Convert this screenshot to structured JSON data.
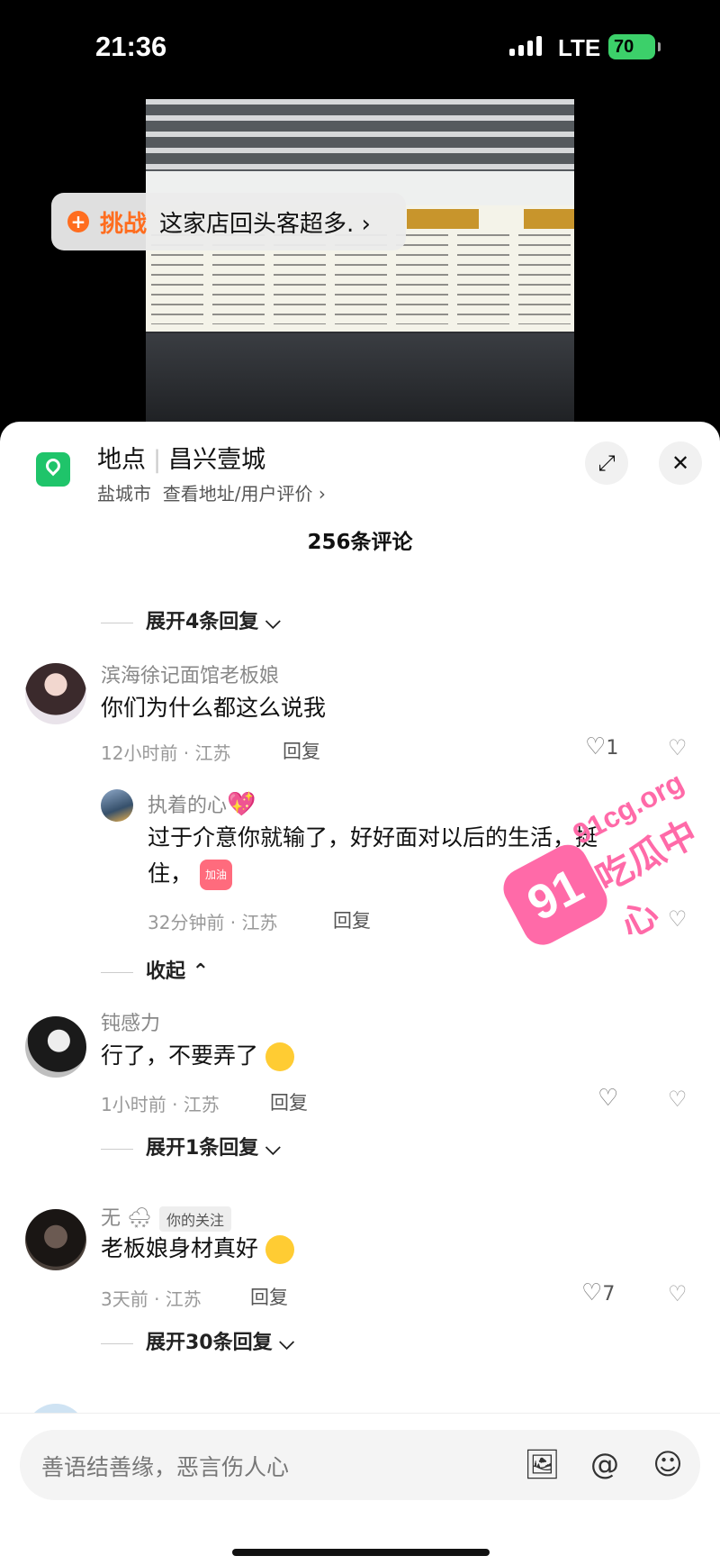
{
  "status_bar": {
    "time": "21:36",
    "network": "LTE",
    "battery": "70"
  },
  "video": {
    "challenge_label": "挑战",
    "challenge_text": "这家店回头客超多.",
    "chevron": "›"
  },
  "location": {
    "title_prefix": "地点",
    "name": "昌兴壹城",
    "city": "盐城市",
    "link": "查看地址/用户评价 ›",
    "icon": "location-pin-icon"
  },
  "comments_count": "256条评论",
  "expand_top": "展开4条回复 ⌵",
  "comments": [
    {
      "user": "滨海徐记面馆老板娘",
      "text": "你们为什么都这么说我",
      "meta": "12小时前 · 江苏",
      "reply": "回复",
      "likes": "1"
    },
    {
      "user": "执着的心",
      "text_line1": "过于介意你就输了，好好面对以后的生活，挺",
      "text_line2": "住，",
      "sticker": "加油",
      "meta": "32分钟前 · 江苏",
      "reply": "回复"
    },
    {
      "collapse": "收起 ⌃"
    },
    {
      "user": "钝感力",
      "text": "行了，不要弄了",
      "meta": "1小时前 · 江苏",
      "reply": "回复"
    },
    {
      "expand": "展开1条回复 ⌵"
    },
    {
      "user": "无",
      "badge": "你的关注",
      "text": "老板娘身材真好",
      "meta": "3天前 · 江苏",
      "reply": "回复",
      "likes": "7"
    },
    {
      "expand": "展开30条回复 ⌵"
    }
  ],
  "watermark": {
    "number": "91",
    "url": "91cg.org",
    "cn": "吃瓜中心"
  },
  "input": {
    "placeholder": "善语结善缘，恶言伤人心"
  }
}
